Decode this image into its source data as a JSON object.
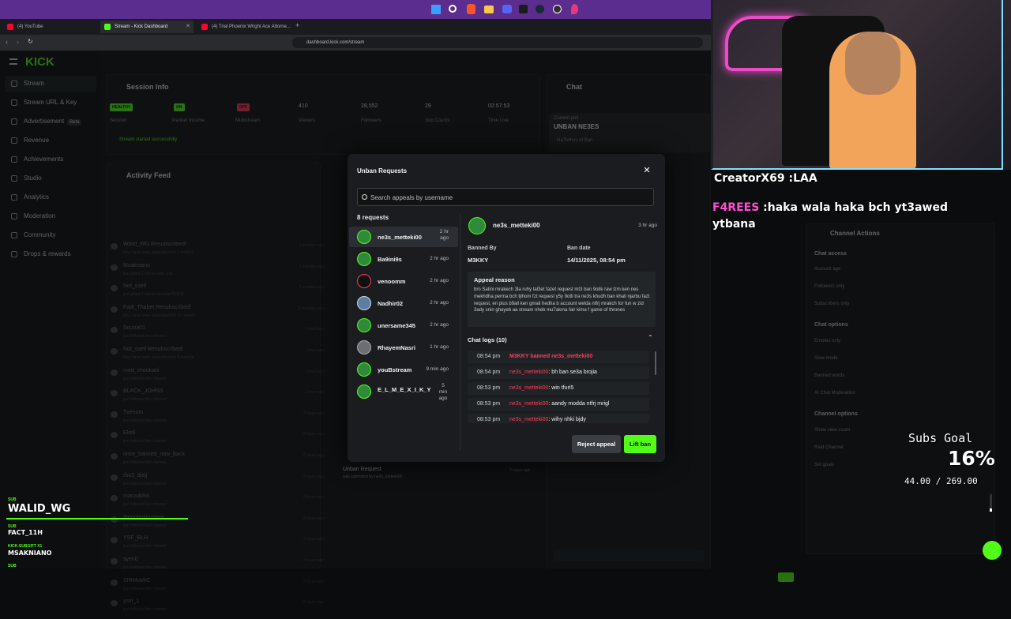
{
  "browser": {
    "tabs": [
      {
        "label": "(4) YouTube"
      },
      {
        "label": "Stream - Kick Dashboard"
      },
      {
        "label": "(4) Trial Phoenix Wright Ace Attorne..."
      }
    ],
    "url": "dashboard.kick.com/stream"
  },
  "sidebar": {
    "logo": "KICK",
    "items": [
      {
        "label": "Stream"
      },
      {
        "label": "Stream URL & Key"
      },
      {
        "label": "Advertisement",
        "badge": "Beta"
      },
      {
        "label": "Revenue"
      },
      {
        "label": "Achievements"
      },
      {
        "label": "Studio"
      },
      {
        "label": "Analytics"
      },
      {
        "label": "Moderation"
      },
      {
        "label": "Community"
      },
      {
        "label": "Drops & rewards"
      }
    ]
  },
  "session": {
    "title": "Session Info",
    "stats": [
      {
        "chip": "HEALTHY",
        "label": "Session"
      },
      {
        "chip": "ON",
        "label": "Partner Income"
      },
      {
        "chip": "OFF",
        "label": "Multistream"
      },
      {
        "value": "410",
        "label": "Viewers"
      },
      {
        "value": "28,552",
        "label": "Followers"
      },
      {
        "value": "29",
        "label": "Sub Counts"
      },
      {
        "value": "02:57:53",
        "label": "Time Live"
      }
    ],
    "status": "Stream started successfully"
  },
  "activity": {
    "title": "Activity Feed",
    "items": [
      {
        "name": "Walid_WG Resubscribed!",
        "sub": "they have been subscribed for 7 months",
        "time": "7 minutes ago"
      },
      {
        "name": "Msakniano",
        "sub": "just gifted 1 sub to Fact_11h",
        "time": "7 minutes ago"
      },
      {
        "name": "Not_sseif",
        "sub": "just gifted 1 sub to kenzola7111111",
        "time": "7 minutes ago"
      },
      {
        "name": "Fadi_Thabet Resubscribed!",
        "sub": "they have been subscribed for 12 months",
        "time": "12 minutes ago"
      },
      {
        "name": "Souna01",
        "sub": "just followed the channel",
        "time": "1 hour ago"
      },
      {
        "name": "Not_sseif Resubscribed!",
        "sub": "they have been subscribed for 8 months",
        "time": "1 hour ago"
      },
      {
        "name": "med_choukani",
        "sub": "just followed the channel",
        "time": "1 hour ago"
      },
      {
        "name": "BLACK_JOHNS",
        "sub": "just followed the channel",
        "time": "1 hour ago"
      },
      {
        "name": "Tvenom",
        "sub": "just followed the channel",
        "time": "2 hours ago"
      },
      {
        "name": "Elio9",
        "sub": "just followed the channel",
        "time": "2 hours ago"
      },
      {
        "name": "once_banned_now_back",
        "sub": "just followed the channel",
        "time": "2 hours ago"
      },
      {
        "name": "rbo3_djejj",
        "sub": "just followed the channel",
        "time": "2 hours ago"
      },
      {
        "name": "marouki94",
        "sub": "just followed the channel",
        "time": "2 hours ago"
      },
      {
        "name": "thenotoriiousava",
        "sub": "just followed the channel",
        "time": "2 hours ago"
      },
      {
        "name": "YSF_BLH",
        "sub": "just followed the channel",
        "time": "2 hours ago"
      },
      {
        "name": "syen0",
        "sub": "just followed the channel",
        "time": "2 hours ago"
      },
      {
        "name": "SIRMoMIC",
        "sub": "just followed the channel",
        "time": "2 hours ago"
      },
      {
        "name": "ysin_1",
        "sub": "just followed the channel",
        "time": "2 hours ago"
      }
    ],
    "unban_row": {
      "name": "Unban Request",
      "sub": "was submitted by ne3s_metteki00",
      "time": "2 hours ago"
    }
  },
  "chat": {
    "title": "Chat",
    "poll_label": "Current poll",
    "poll_title": "UNBAN NE3ES",
    "poll_option": "Na7lwhou el Ban"
  },
  "channel_actions": {
    "title": "Channel Actions",
    "chat_access": "Chat access",
    "items": [
      "Account age",
      "Followers only",
      "Subscribers only"
    ],
    "chat_options": "Chat options",
    "items2": [
      "Emotes only",
      "Slow mode",
      "Banned words",
      "AI Chat Moderation"
    ],
    "channel_options": "Channel options",
    "items3": [
      "Show view count",
      "Raid Channel",
      "Set goals"
    ]
  },
  "modal": {
    "title": "Unban Requests",
    "search_placeholder": "Search appeals by username",
    "count": "8 requests",
    "requests": [
      {
        "name": "ne3s_metteki00",
        "time": "2 hr ago"
      },
      {
        "name": "Ba9ini9s",
        "time": "2 hr ago"
      },
      {
        "name": "venoomm",
        "time": "2 hr ago"
      },
      {
        "name": "Nadhir02",
        "time": "2 hr ago"
      },
      {
        "name": "unersame345",
        "time": "2 hr ago"
      },
      {
        "name": "RhayemNasri",
        "time": "1 hr ago"
      },
      {
        "name": "youBstream",
        "time": "9 min ago"
      },
      {
        "name": "E_L_M_E_X_I_K_Y",
        "time": "5 min ago"
      }
    ],
    "detail": {
      "name": "ne3s_metteki00",
      "time": "3 hr ago",
      "banned_by_label": "Banned By",
      "banned_by": "M3KKY",
      "ban_date_label": "Ban date",
      "ban_date": "14/11/2025, 08:54 pm",
      "reason_label": "Appeal reason",
      "reason": "bro Satini mrakech 3la ruhy tal3et fazet request mt3 ban 9otik raw lzm ken nes mekhdha perma bch tjihom fzt request y5y 9otli tra ne3s khudh ban khali njarbu fazt request, en plus b9all ken gmail hedha b account welda ntfrj mrakch for fun w zid 3ady snin ghayeb aa stream nheb mu7akma fair kima f game of thrones",
      "logs_label": "Chat logs (10)",
      "logs": [
        {
          "time": "08:54 pm",
          "user": "M3KKY banned ne3s_metteki00",
          "text": ""
        },
        {
          "time": "08:54 pm",
          "user": "ne3s_metteki00",
          "text": ": bh ban se3a brojia"
        },
        {
          "time": "08:53 pm",
          "user": "ne3s_metteki00",
          "text": ": win tfuri5"
        },
        {
          "time": "08:53 pm",
          "user": "ne3s_metteki00",
          "text": ": aandy modda ntfrj mrigl"
        },
        {
          "time": "08:53 pm",
          "user": "ne3s_metteki00",
          "text": ": wihy nhki bjdy"
        }
      ],
      "reject_label": "Reject appeal",
      "lift_label": "Lift ban"
    }
  },
  "overlay": {
    "chat1_user": "CreatorX69",
    "chat1_text": " :LAA",
    "chat2_user": "F4REES",
    "chat2_text": " :haka wala haka bch yt3awed ytbana",
    "subs_goal_label": "Subs Goal",
    "subs_goal_pct": "16%",
    "subs_goal_count": "44.00 / 269.00",
    "subs_goal_fraction": 0.16,
    "recent": [
      {
        "tag": "SUB",
        "name": "WALID_WG"
      },
      {
        "tag": "SUB",
        "name": "FACT_11H"
      },
      {
        "tag": "KICK-SUBGIFT X1",
        "name": "MSAKNIANO"
      },
      {
        "tag": "SUB",
        "name": ""
      }
    ]
  },
  "colors": {
    "accent": "#53fc18",
    "danger": "#ff3b5c",
    "taskbar": "#5b2d8e"
  }
}
